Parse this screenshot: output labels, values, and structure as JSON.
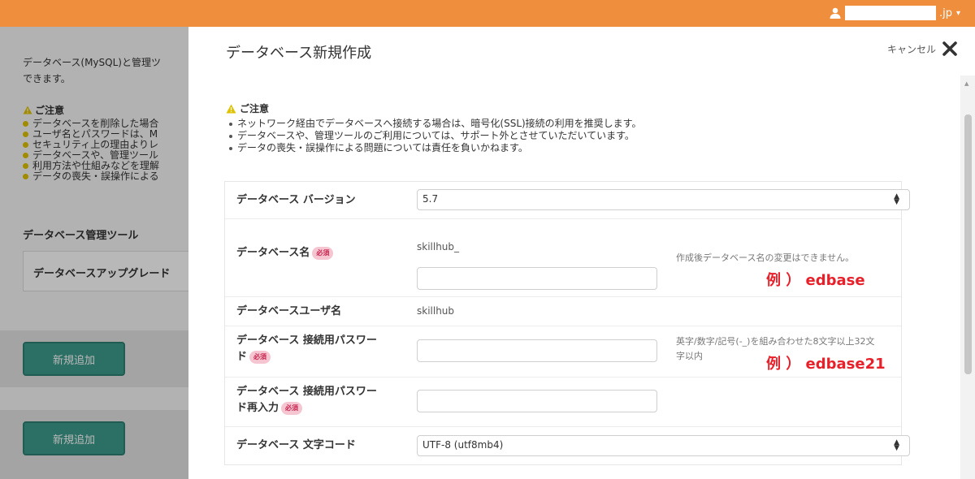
{
  "header": {
    "user_domain": ".jp"
  },
  "background_page": {
    "intro_lines": [
      "データベース(MySQL)と管理ツ",
      "できます。"
    ],
    "notice_title": "ご注意",
    "notice_items": [
      "データベースを削除した場合",
      "ユーザ名とパスワードは、M",
      "セキュリティ上の理由よりレ",
      "データベースや、管理ツール",
      "利用方法や仕組みなどを理解",
      "データの喪失・誤操作による"
    ],
    "tools_title": "データベース管理ツール",
    "upgrade_card_label": "データベースアップグレード",
    "add_button_1": "新規追加",
    "add_button_2": "新規追加"
  },
  "modal": {
    "title": "データベース新規作成",
    "cancel_label": "キャンセル",
    "notice": {
      "title": "ご注意",
      "items": [
        "ネットワーク経由でデータベースへ接続する場合は、暗号化(SSL)接続の利用を推奨します。",
        "データベースや、管理ツールのご利用については、サポート外とさせていただいています。",
        "データの喪失・誤操作による問題については責任を負いかねます。"
      ]
    },
    "form": {
      "required_badge": "必須",
      "version": {
        "label": "データベース バージョン",
        "value": "5.7"
      },
      "db_name": {
        "label": "データベース名",
        "prefix": "skillhub_",
        "value": "",
        "help": "作成後データベース名の変更はできません。",
        "example": "例 ） edbase"
      },
      "db_user": {
        "label": "データベースユーザ名",
        "value": "skillhub"
      },
      "password": {
        "label_line1": "データベース 接続用パスワー",
        "label_line2": "ド",
        "value": "",
        "help_line1": "英字/数字/記号(-_)を組み合わせた8文字以上32文",
        "help_line2": "字以内",
        "example": "例 ） edbase21"
      },
      "password_confirm": {
        "label_line1": "データベース 接続用パスワー",
        "label_line2": "ド再入力",
        "value": ""
      },
      "charset": {
        "label": "データベース 文字コード",
        "value": "UTF-8 (utf8mb4)"
      }
    }
  },
  "colors": {
    "header": "#ef8e3c",
    "add_button": "#3e9b8d",
    "example_text": "#e8202a",
    "required_badge_bg": "#f5c6d2",
    "notice_warning": "#e0c300"
  }
}
